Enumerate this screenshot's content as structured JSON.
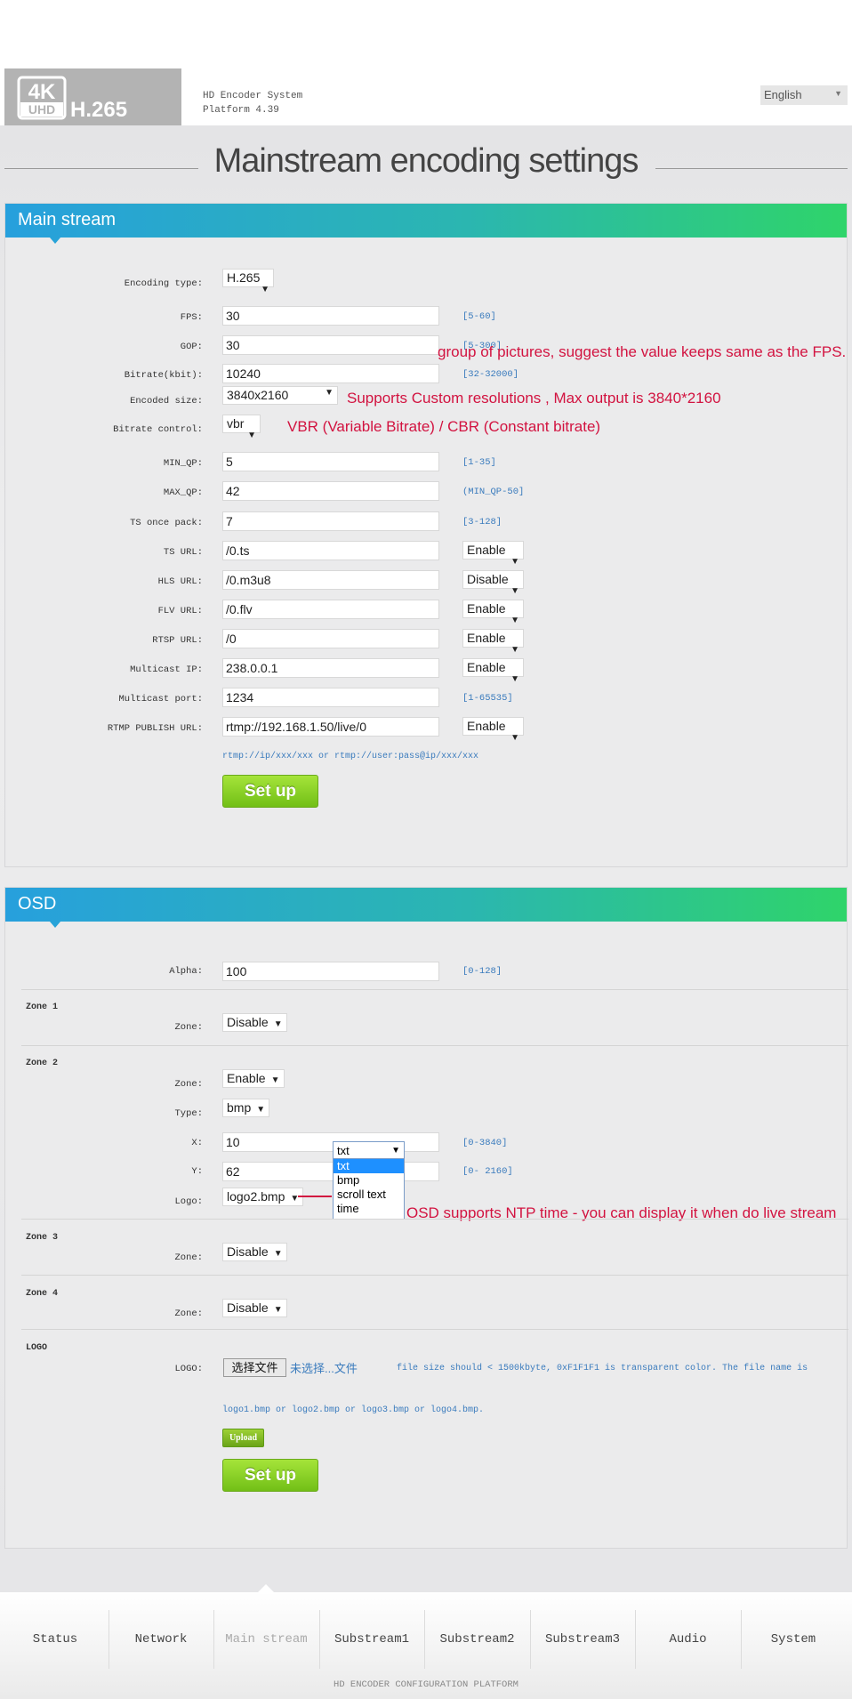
{
  "header": {
    "logo_text": "4K UHD H.265",
    "system_name": "HD Encoder System",
    "platform": "Platform 4.39",
    "language": "English"
  },
  "page_title": "Mainstream encoding settings",
  "main_stream": {
    "title": "Main stream",
    "rows": [
      {
        "label": "Encoding type:",
        "type": "select",
        "value": "H.265"
      },
      {
        "label": "FPS:",
        "type": "input",
        "value": "30",
        "range": "[5-60]"
      },
      {
        "label": "GOP:",
        "type": "input",
        "value": "30",
        "range": "[5-300]"
      },
      {
        "label": "Bitrate(kbit):",
        "type": "input",
        "value": "10240",
        "range": "[32-32000]"
      },
      {
        "label": "Encoded size:",
        "type": "select",
        "value": "3840x2160"
      },
      {
        "label": "Bitrate control:",
        "type": "select",
        "value": "vbr"
      },
      {
        "label": "MIN_QP:",
        "type": "input",
        "value": "5",
        "range": "[1-35]"
      },
      {
        "label": "MAX_QP:",
        "type": "input",
        "value": "42",
        "range": "(MIN_QP-50]"
      },
      {
        "label": "TS once pack:",
        "type": "input",
        "value": "7",
        "range": "[3-128]"
      },
      {
        "label": "TS URL:",
        "type": "input",
        "value": "/0.ts",
        "toggle": "Enable"
      },
      {
        "label": "HLS URL:",
        "type": "input",
        "value": "/0.m3u8",
        "toggle": "Disable"
      },
      {
        "label": "FLV URL:",
        "type": "input",
        "value": "/0.flv",
        "toggle": "Enable"
      },
      {
        "label": "RTSP URL:",
        "type": "input",
        "value": "/0",
        "toggle": "Enable"
      },
      {
        "label": "Multicast IP:",
        "type": "input",
        "value": "238.0.0.1",
        "toggle": "Enable"
      },
      {
        "label": "Multicast port:",
        "type": "input",
        "value": "1234",
        "range": "[1-65535]"
      },
      {
        "label": "RTMP PUBLISH URL:",
        "type": "input",
        "value": "rtmp://192.168.1.50/live/0",
        "toggle": "Enable"
      }
    ],
    "rtmp_hint": "rtmp://ip/xxx/xxx or rtmp://user:pass@ip/xxx/xxx",
    "setup_label": "Set up"
  },
  "annotations": {
    "gop": "group of pictures, suggest the value keeps same as the FPS.",
    "size": "Supports Custom resolutions , Max output is 3840*2160",
    "bitrate": "VBR (Variable Bitrate) / CBR (Constant bitrate)",
    "osd": "OSD supports NTP time - you can display it when do live stream"
  },
  "osd": {
    "title": "OSD",
    "alpha": {
      "label": "Alpha:",
      "value": "100",
      "range": "[0-128]"
    },
    "zone1": {
      "title": "Zone 1",
      "zone_label": "Zone:",
      "zone_value": "Disable"
    },
    "zone2": {
      "title": "Zone 2",
      "zone_label": "Zone:",
      "zone_value": "Enable",
      "type_label": "Type:",
      "type_value": "bmp",
      "x_label": "X:",
      "x_value": "10",
      "x_range": "[0-3840]",
      "y_label": "Y:",
      "y_value": "62",
      "y_range": "[0- 2160]",
      "logo_label": "Logo:",
      "logo_value": "logo2.bmp"
    },
    "dropdown": {
      "selected": "txt",
      "options": [
        "txt",
        "bmp",
        "scroll text",
        "time"
      ]
    },
    "zone3": {
      "title": "Zone 3",
      "zone_label": "Zone:",
      "zone_value": "Disable"
    },
    "zone4": {
      "title": "Zone 4",
      "zone_label": "Zone:",
      "zone_value": "Disable"
    },
    "logo": {
      "title": "LOGO",
      "label": "LOGO:",
      "choose_file": "选择文件",
      "no_file": "未选择...文件",
      "hint1": "file size should < 1500kbyte, 0xF1F1F1 is transparent color. The file name is",
      "hint2": "logo1.bmp or logo2.bmp or logo3.bmp or logo4.bmp.",
      "upload_label": "Upload"
    },
    "setup_label": "Set up"
  },
  "nav": {
    "active": "Main stream",
    "items": [
      "Status",
      "Network",
      "Main stream",
      "Substream1",
      "Substream2",
      "Substream3",
      "Audio",
      "System"
    ]
  },
  "footer_text": "HD ENCODER CONFIGURATION PLATFORM",
  "colors": {
    "accent_start": "#27a0dd",
    "accent_end": "#2fd46a",
    "annotation": "#d21340",
    "button": "#8fd228",
    "range_text": "#3a7bbd"
  }
}
